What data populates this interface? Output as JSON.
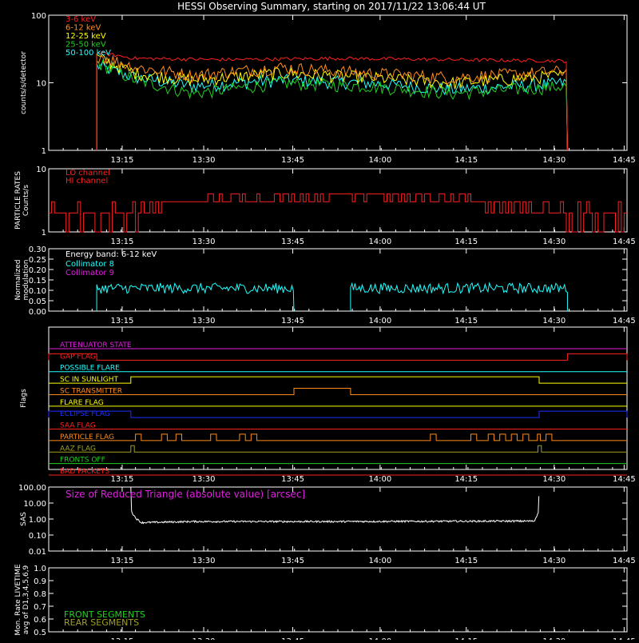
{
  "title": "HESSI Observing Summary, starting on 2017/11/22 13:06:44 UT",
  "time_ticks": [
    "13:15",
    "13:30",
    "13:45",
    "14:00",
    "14:15",
    "14:30",
    "14:45"
  ],
  "colors": {
    "red": "#ff2020",
    "orange": "#ff8c1a",
    "yellow": "#ffff00",
    "green": "#20d020",
    "cyan": "#20ffff",
    "magenta": "#e020e0",
    "blue": "#2030ff",
    "olive": "#a0a020",
    "white": "#ffffff",
    "axis": "#ffffff",
    "black": "#000000"
  },
  "chart_data": [
    {
      "type": "line",
      "panel": "counts",
      "ylabel": "counts/s/detector",
      "yscale": "log",
      "ylim": [
        1,
        100
      ],
      "ytick_labels": [
        "1",
        "10",
        "100"
      ],
      "xrange_min": [
        0,
        100
      ],
      "data_window_min": [
        8.3,
        89.7
      ],
      "series": [
        {
          "name": "3-6 keV",
          "color": "red",
          "x": [
            8.3,
            15,
            30,
            50,
            70,
            89.7
          ],
          "values": [
            28,
            23,
            22,
            23,
            22,
            21
          ]
        },
        {
          "name": "6-12 keV",
          "color": "orange",
          "x": [
            8.3,
            15,
            25,
            40,
            55,
            70,
            89.7
          ],
          "values": [
            26,
            17,
            13,
            17,
            14,
            12,
            15
          ]
        },
        {
          "name": "12-25 keV",
          "color": "yellow",
          "x": [
            8.3,
            15,
            25,
            40,
            55,
            70,
            89.7
          ],
          "values": [
            24,
            14,
            11,
            14,
            12,
            10,
            13
          ]
        },
        {
          "name": "25-50 keV",
          "color": "green",
          "x": [
            8.3,
            15,
            25,
            40,
            55,
            70,
            89.7
          ],
          "values": [
            20,
            11,
            7,
            10,
            9,
            7,
            9
          ]
        },
        {
          "name": "50-100 keV",
          "color": "cyan",
          "x": [
            8.3,
            15,
            25,
            40,
            55,
            70,
            89.7
          ],
          "values": [
            18,
            12,
            9,
            11,
            10,
            8,
            10
          ]
        }
      ]
    },
    {
      "type": "line",
      "panel": "particle",
      "ylabel": "PARTICLE RATES",
      "ylabel2": "Counts/s",
      "yscale": "log",
      "ylim": [
        1,
        10
      ],
      "ytick_labels": [
        "1",
        "10"
      ],
      "series": [
        {
          "name": "LO channel",
          "color": "red",
          "x": [
            0,
            8,
            14,
            22,
            40,
            55,
            72,
            85,
            90,
            100
          ],
          "values": [
            2,
            2,
            2,
            3,
            3.5,
            4,
            3,
            2.5,
            2,
            2
          ]
        },
        {
          "name": "HI channel",
          "color": "red",
          "x": [],
          "values": []
        }
      ]
    },
    {
      "type": "line",
      "panel": "modulation",
      "ylabel": "Normalized",
      "ylabel2": "modulation",
      "ylim": [
        0,
        0.3
      ],
      "ytick_labels": [
        "0.00",
        "0.05",
        "0.10",
        "0.15",
        "0.20",
        "0.25",
        "0.30"
      ],
      "annotation": "Energy band: 6-12 keV",
      "series": [
        {
          "name": "Collimator 8",
          "color": "cyan",
          "segments": [
            [
              8.3,
              42.4
            ],
            [
              52.2,
              89.7
            ]
          ],
          "values": [
            0.11,
            0.11
          ]
        },
        {
          "name": "Collimator 9",
          "color": "magenta",
          "x": [],
          "values": []
        }
      ]
    },
    {
      "type": "table",
      "panel": "flags",
      "ylabel": "Flags",
      "series": [
        {
          "name": "ATTENUATOR STATE",
          "color": "magenta",
          "intervals": []
        },
        {
          "name": "GAP FLAG",
          "color": "red",
          "intervals": [
            [
              0,
              8.3
            ],
            [
              89.7,
              100
            ]
          ]
        },
        {
          "name": "POSSIBLE FLARE",
          "color": "cyan",
          "intervals": []
        },
        {
          "name": "SC IN SUNLIGHT",
          "color": "yellow",
          "intervals": [
            [
              14.2,
              84.8
            ]
          ]
        },
        {
          "name": "SC TRANSMITTER",
          "color": "orange",
          "intervals": [
            [
              42.4,
              52.2
            ]
          ]
        },
        {
          "name": "FLARE FLAG",
          "color": "yellow",
          "intervals": []
        },
        {
          "name": "ECLIPSE FLAG",
          "color": "blue",
          "intervals": [
            [
              0,
              14.2
            ],
            [
              84.8,
              100
            ]
          ]
        },
        {
          "name": "SAA FLAG",
          "color": "red",
          "intervals": []
        },
        {
          "name": "PARTICLE FLAG",
          "color": "orange",
          "intervals": [
            [
              15,
              16
            ],
            [
              19.5,
              20.5
            ],
            [
              22,
              23
            ],
            [
              28,
              29
            ],
            [
              33,
              34
            ],
            [
              35,
              36
            ],
            [
              66,
              67
            ],
            [
              73,
              74
            ],
            [
              76,
              77
            ],
            [
              78,
              79
            ],
            [
              80,
              81
            ],
            [
              82,
              83
            ],
            [
              84.5,
              85
            ],
            [
              86,
              87
            ]
          ]
        },
        {
          "name": "AAZ FLAG",
          "color": "olive",
          "intervals": [
            [
              14.2,
              14.8
            ],
            [
              84.6,
              85.2
            ]
          ]
        },
        {
          "name": "FRONTS OFF",
          "color": "green",
          "intervals": []
        },
        {
          "name": "BAD PACKETS",
          "color": "red",
          "intervals": []
        }
      ]
    },
    {
      "type": "line",
      "panel": "sas",
      "ylabel": "SAS",
      "yscale": "log",
      "ylim": [
        0.01,
        100
      ],
      "ytick_labels": [
        "0.01",
        "0.10",
        "1.00",
        "10.00",
        "100.00"
      ],
      "annotation": "Size of Reduced Triangle (absolute value) [arcsec]",
      "series": [
        {
          "name": "",
          "color": "white",
          "x": [
            14.2,
            14.3,
            15,
            16,
            25,
            50,
            84,
            84.7,
            84.8
          ],
          "values": [
            100,
            3,
            1.2,
            0.6,
            0.7,
            0.7,
            0.75,
            3,
            100
          ]
        }
      ]
    },
    {
      "type": "line",
      "panel": "livetime",
      "ylabel": "Mon. Rate LIVETIME",
      "ylabel2": "avg of D1,3,4,5,6,9",
      "ylim": [
        0.5,
        1.0
      ],
      "ytick_labels": [
        "0.5",
        "0.6",
        "0.7",
        "0.8",
        "0.9",
        "1.0"
      ],
      "series": [
        {
          "name": "FRONT SEGMENTS",
          "color": "green",
          "x": [],
          "values": []
        },
        {
          "name": "REAR SEGMENTS",
          "color": "olive",
          "x": [],
          "values": []
        }
      ]
    }
  ]
}
